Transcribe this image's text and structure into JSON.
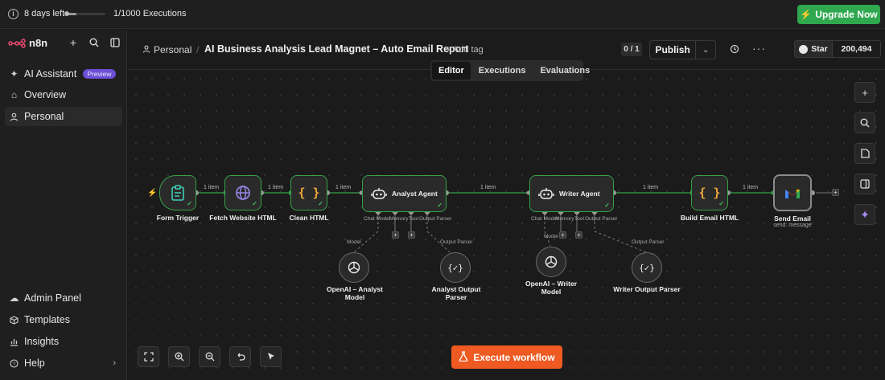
{
  "topbar": {
    "trial_text": "8 days left",
    "trial_progress": 0.27,
    "executions_text": "1/1000 Executions",
    "upgrade_label": "Upgrade Now",
    "upgrade_color": "#2fa84f"
  },
  "sidebar": {
    "logo_text": "n8n",
    "items": [
      {
        "label": "AI Assistant",
        "icon": "sparkle-icon",
        "badge": "Preview"
      },
      {
        "label": "Overview",
        "icon": "home-icon"
      },
      {
        "label": "Personal",
        "icon": "user-icon"
      }
    ],
    "bottom_items": [
      {
        "label": "Admin Panel",
        "icon": "cloud-icon"
      },
      {
        "label": "Templates",
        "icon": "box-icon"
      },
      {
        "label": "Insights",
        "icon": "chart-icon"
      },
      {
        "label": "Help",
        "icon": "help-icon"
      }
    ]
  },
  "header": {
    "breadcrumb_project": "Personal",
    "workflow_title": "AI Business Analysis Lead Magnet – Auto Email Report",
    "add_tag_label": "+ Add tag",
    "version_counter": "0 / 1",
    "publish_label": "Publish",
    "github_star_label": "Star",
    "github_star_count": "200,494"
  },
  "tabs": [
    {
      "label": "Editor",
      "active": true
    },
    {
      "label": "Executions",
      "active": false
    },
    {
      "label": "Evaluations",
      "active": false
    }
  ],
  "workflow": {
    "nodes": {
      "form_trigger": "Form Trigger",
      "fetch_html": "Fetch Website HTML",
      "clean_html": "Clean HTML",
      "analyst_agent": "Analyst Agent",
      "writer_agent": "Writer Agent",
      "build_email": "Build Email HTML",
      "send_email": "Send Email",
      "send_email_sub": "send: message",
      "openai_analyst": "OpenAI – Analyst Model",
      "analyst_parser": "Analyst Output Parser",
      "openai_writer": "OpenAI – Writer Model",
      "writer_parser": "Writer Output Parser"
    },
    "edge_label": "1 item",
    "ports": {
      "chat_model": "Chat Model",
      "memory": "Memory",
      "tool": "Tool",
      "output_parser": "Output Parser",
      "model": "Model"
    },
    "success_color": "#37a148"
  },
  "execute_label": "Execute workflow",
  "execute_color": "#ee5a21"
}
